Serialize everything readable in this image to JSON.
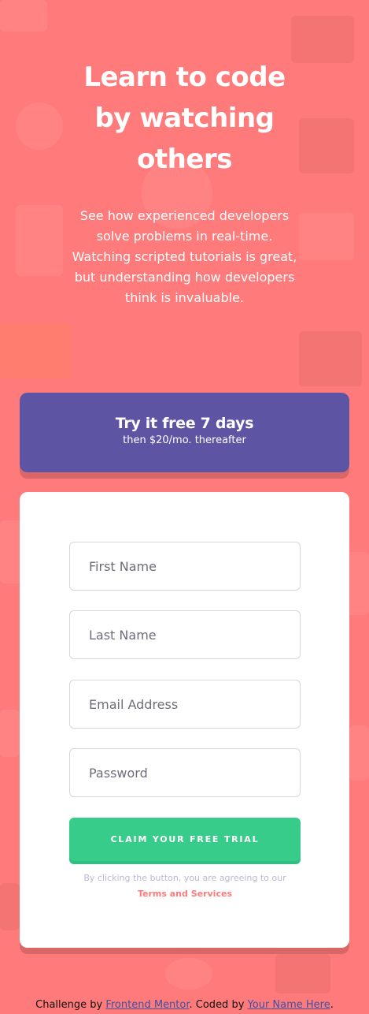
{
  "hero": {
    "title": "Learn to code by watching others",
    "description": "See how experienced developers solve problems in real-time. Watching scripted tutorials is great, but understanding how developers think is invaluable."
  },
  "promo": {
    "title": "Try it free 7 days",
    "subtitle": "then $20/mo. thereafter"
  },
  "form": {
    "first_name_placeholder": "First Name",
    "last_name_placeholder": "Last Name",
    "email_placeholder": "Email Address",
    "password_placeholder": "Password",
    "submit_label": "CLAIM YOUR FREE TRIAL",
    "terms_prefix": "By clicking the button, you are agreeing to our",
    "terms_link": "Terms and Services"
  },
  "footer": {
    "challenge_prefix": "Challenge by ",
    "challenge_link": "Frontend Mentor",
    "coded_prefix": ". Coded by ",
    "coded_link": "Your Name Here",
    "suffix": "."
  },
  "colors": {
    "background": "#ff7a7a",
    "promo": "#5e54a4",
    "button": "#38cc8b",
    "link": "#ff7a7a"
  }
}
